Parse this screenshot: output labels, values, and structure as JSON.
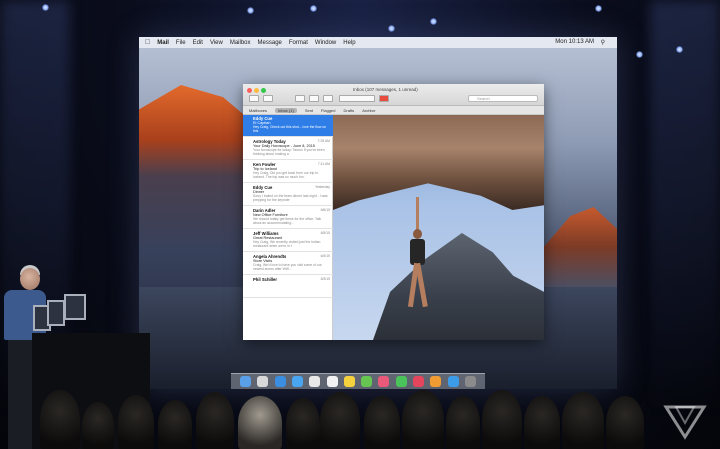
{
  "scene": {
    "description_colors": {
      "screen_bg": "#8e9bb4",
      "accent_selection": "#2f7ee8"
    }
  },
  "menubar": {
    "apple_icon": "apple-icon",
    "items": [
      "Mail",
      "File",
      "Edit",
      "View",
      "Mailbox",
      "Message",
      "Format",
      "Window",
      "Help"
    ],
    "clock": "Mon 10:13 AM"
  },
  "mail": {
    "window_title": "Inbox (107 messages, 1 unread)",
    "search_placeholder": "Search",
    "favorites": [
      "Mailboxes",
      "Inbox (1)",
      "Sent",
      "Flagged",
      "Drafts",
      "Archive"
    ],
    "messages": [
      {
        "from": "Eddy Cue",
        "subject": "El Capitan",
        "preview": "Hey Craig, Check out this shot... love the flow on this",
        "date": ""
      },
      {
        "from": "Astrology Today",
        "subject": "Your Daily Horoscope - June 8, 2015",
        "preview": "Your horoscope for today: Taurus If you've been thinking about making a",
        "date": "7:28 AM"
      },
      {
        "from": "Ken Fowler",
        "subject": "Trip to Iceland",
        "preview": "Hey Craig, Did you get back from our trip to Iceland. The trip was so much fun.",
        "date": "7:11 AM"
      },
      {
        "from": "Eddy Cue",
        "subject": "Dinner",
        "preview": "Sorry I bailed on the team dinner last night - I was prepping for the keynote",
        "date": "Yesterday"
      },
      {
        "from": "Darin Adler",
        "subject": "New Office Furniture",
        "preview": "We should totally get these for the office. Talk about an accommodating...",
        "date": "6/6/15"
      },
      {
        "from": "Jeff Williams",
        "subject": "Great Restaurant",
        "preview": "Hey Craig, We recently visited just the Indian restaurant when we're in t",
        "date": "6/5/15"
      },
      {
        "from": "Angela Ahrendts",
        "subject": "Store Visits",
        "preview": "Craig, We'd love to have you visit some of our newest stores after WW...",
        "date": "6/4/15"
      },
      {
        "from": "Phil Schiller",
        "subject": "",
        "preview": "",
        "date": "6/3/15"
      }
    ]
  },
  "watermark": {
    "logo": "the-verge-logo"
  }
}
